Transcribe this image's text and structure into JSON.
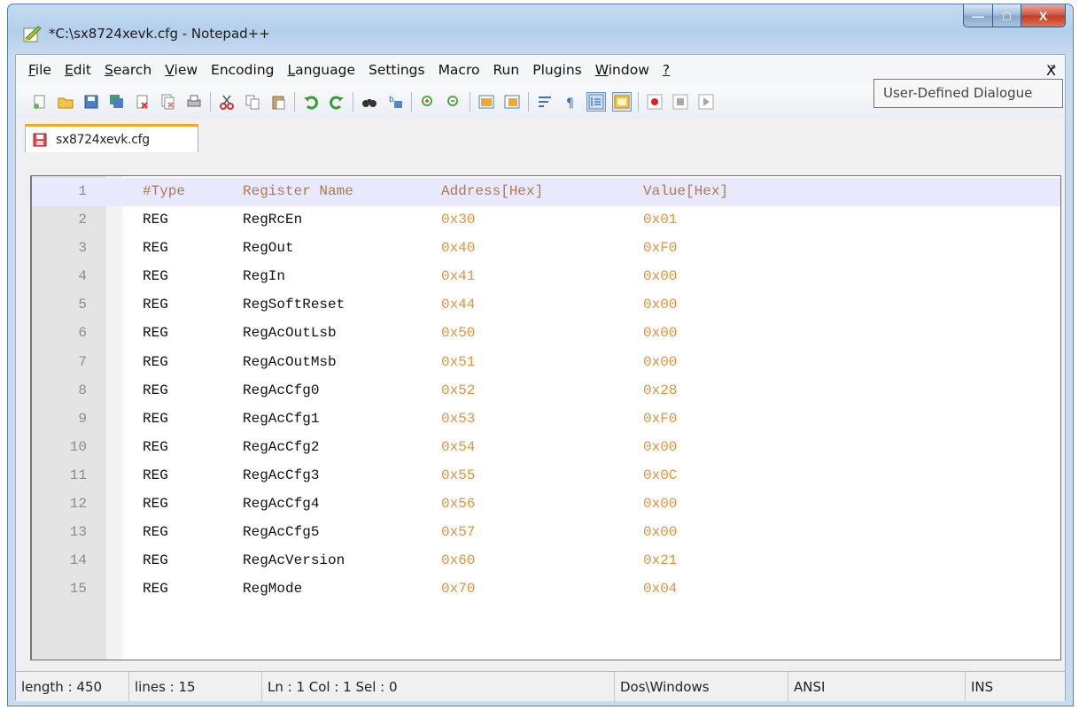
{
  "window": {
    "title": "*C:\\sx8724xevk.cfg - Notepad++",
    "minimize_label": "—",
    "maximize_label": "□",
    "close_label": "X"
  },
  "menu": {
    "items": [
      {
        "u": "F",
        "rest": "ile"
      },
      {
        "u": "E",
        "rest": "dit"
      },
      {
        "u": "S",
        "rest": "earch"
      },
      {
        "u": "V",
        "rest": "iew"
      },
      {
        "u": "",
        "rest": "Encoding"
      },
      {
        "u": "L",
        "rest": "anguage"
      },
      {
        "u": "",
        "rest": "Settings"
      },
      {
        "u": "",
        "rest": "Macro"
      },
      {
        "u": "",
        "rest": "Run"
      },
      {
        "u": "",
        "rest": "Plugins"
      },
      {
        "u": "W",
        "rest": "indow"
      },
      {
        "u": "?",
        "rest": ""
      }
    ],
    "close": "X"
  },
  "toolbar": {
    "overflow": "»",
    "buttons": [
      "new-file",
      "open-file",
      "save",
      "save-all",
      "close",
      "close-all",
      "print",
      "cut",
      "copy",
      "paste",
      "undo",
      "redo",
      "find",
      "replace",
      "zoom-in",
      "zoom-out",
      "sync-vertical",
      "sync-horizontal",
      "word-wrap",
      "show-all-chars",
      "indent-guide",
      "user-defined-dialogue",
      "record-macro",
      "stop-recording",
      "playback-macro"
    ]
  },
  "tab": {
    "label": "sx8724xevk.cfg"
  },
  "tooltip": {
    "text": "User-Defined Dialogue"
  },
  "editor": {
    "lines": [
      {
        "n": "1",
        "c1": "#Type",
        "c2": "Register Name",
        "c3": "Address[Hex]",
        "c4": "Value[Hex]"
      },
      {
        "n": "2",
        "c1": "REG",
        "c2": "RegRcEn",
        "c3": "0x30",
        "c4": "0x01"
      },
      {
        "n": "3",
        "c1": "REG",
        "c2": "RegOut",
        "c3": "0x40",
        "c4": "0xF0"
      },
      {
        "n": "4",
        "c1": "REG",
        "c2": "RegIn",
        "c3": "0x41",
        "c4": "0x00"
      },
      {
        "n": "5",
        "c1": "REG",
        "c2": "RegSoftReset",
        "c3": "0x44",
        "c4": "0x00"
      },
      {
        "n": "6",
        "c1": "REG",
        "c2": "RegAcOutLsb",
        "c3": "0x50",
        "c4": "0x00"
      },
      {
        "n": "7",
        "c1": "REG",
        "c2": "RegAcOutMsb",
        "c3": "0x51",
        "c4": "0x00"
      },
      {
        "n": "8",
        "c1": "REG",
        "c2": "RegAcCfg0",
        "c3": "0x52",
        "c4": "0x28"
      },
      {
        "n": "9",
        "c1": "REG",
        "c2": "RegAcCfg1",
        "c3": "0x53",
        "c4": "0xF0"
      },
      {
        "n": "10",
        "c1": "REG",
        "c2": "RegAcCfg2",
        "c3": "0x54",
        "c4": "0x00"
      },
      {
        "n": "11",
        "c1": "REG",
        "c2": "RegAcCfg3",
        "c3": "0x55",
        "c4": "0x0C"
      },
      {
        "n": "12",
        "c1": "REG",
        "c2": "RegAcCfg4",
        "c3": "0x56",
        "c4": "0x00"
      },
      {
        "n": "13",
        "c1": "REG",
        "c2": "RegAcCfg5",
        "c3": "0x57",
        "c4": "0x00"
      },
      {
        "n": "14",
        "c1": "REG",
        "c2": "RegAcVersion",
        "c3": "0x60",
        "c4": "0x21"
      },
      {
        "n": "15",
        "c1": "REG",
        "c2": "RegMode",
        "c3": "0x70",
        "c4": "0x04"
      }
    ]
  },
  "status": {
    "length": "length : 450",
    "lines": "lines : 15",
    "position": "Ln : 1   Col : 1   Sel : 0",
    "eol": "Dos\\Windows",
    "encoding": "ANSI",
    "mode": "INS"
  },
  "colors": {
    "number": "#e8913a",
    "header_text": "#b07a4a",
    "current_line": "#e8e8ff",
    "tab_accent": "#f5a623"
  }
}
